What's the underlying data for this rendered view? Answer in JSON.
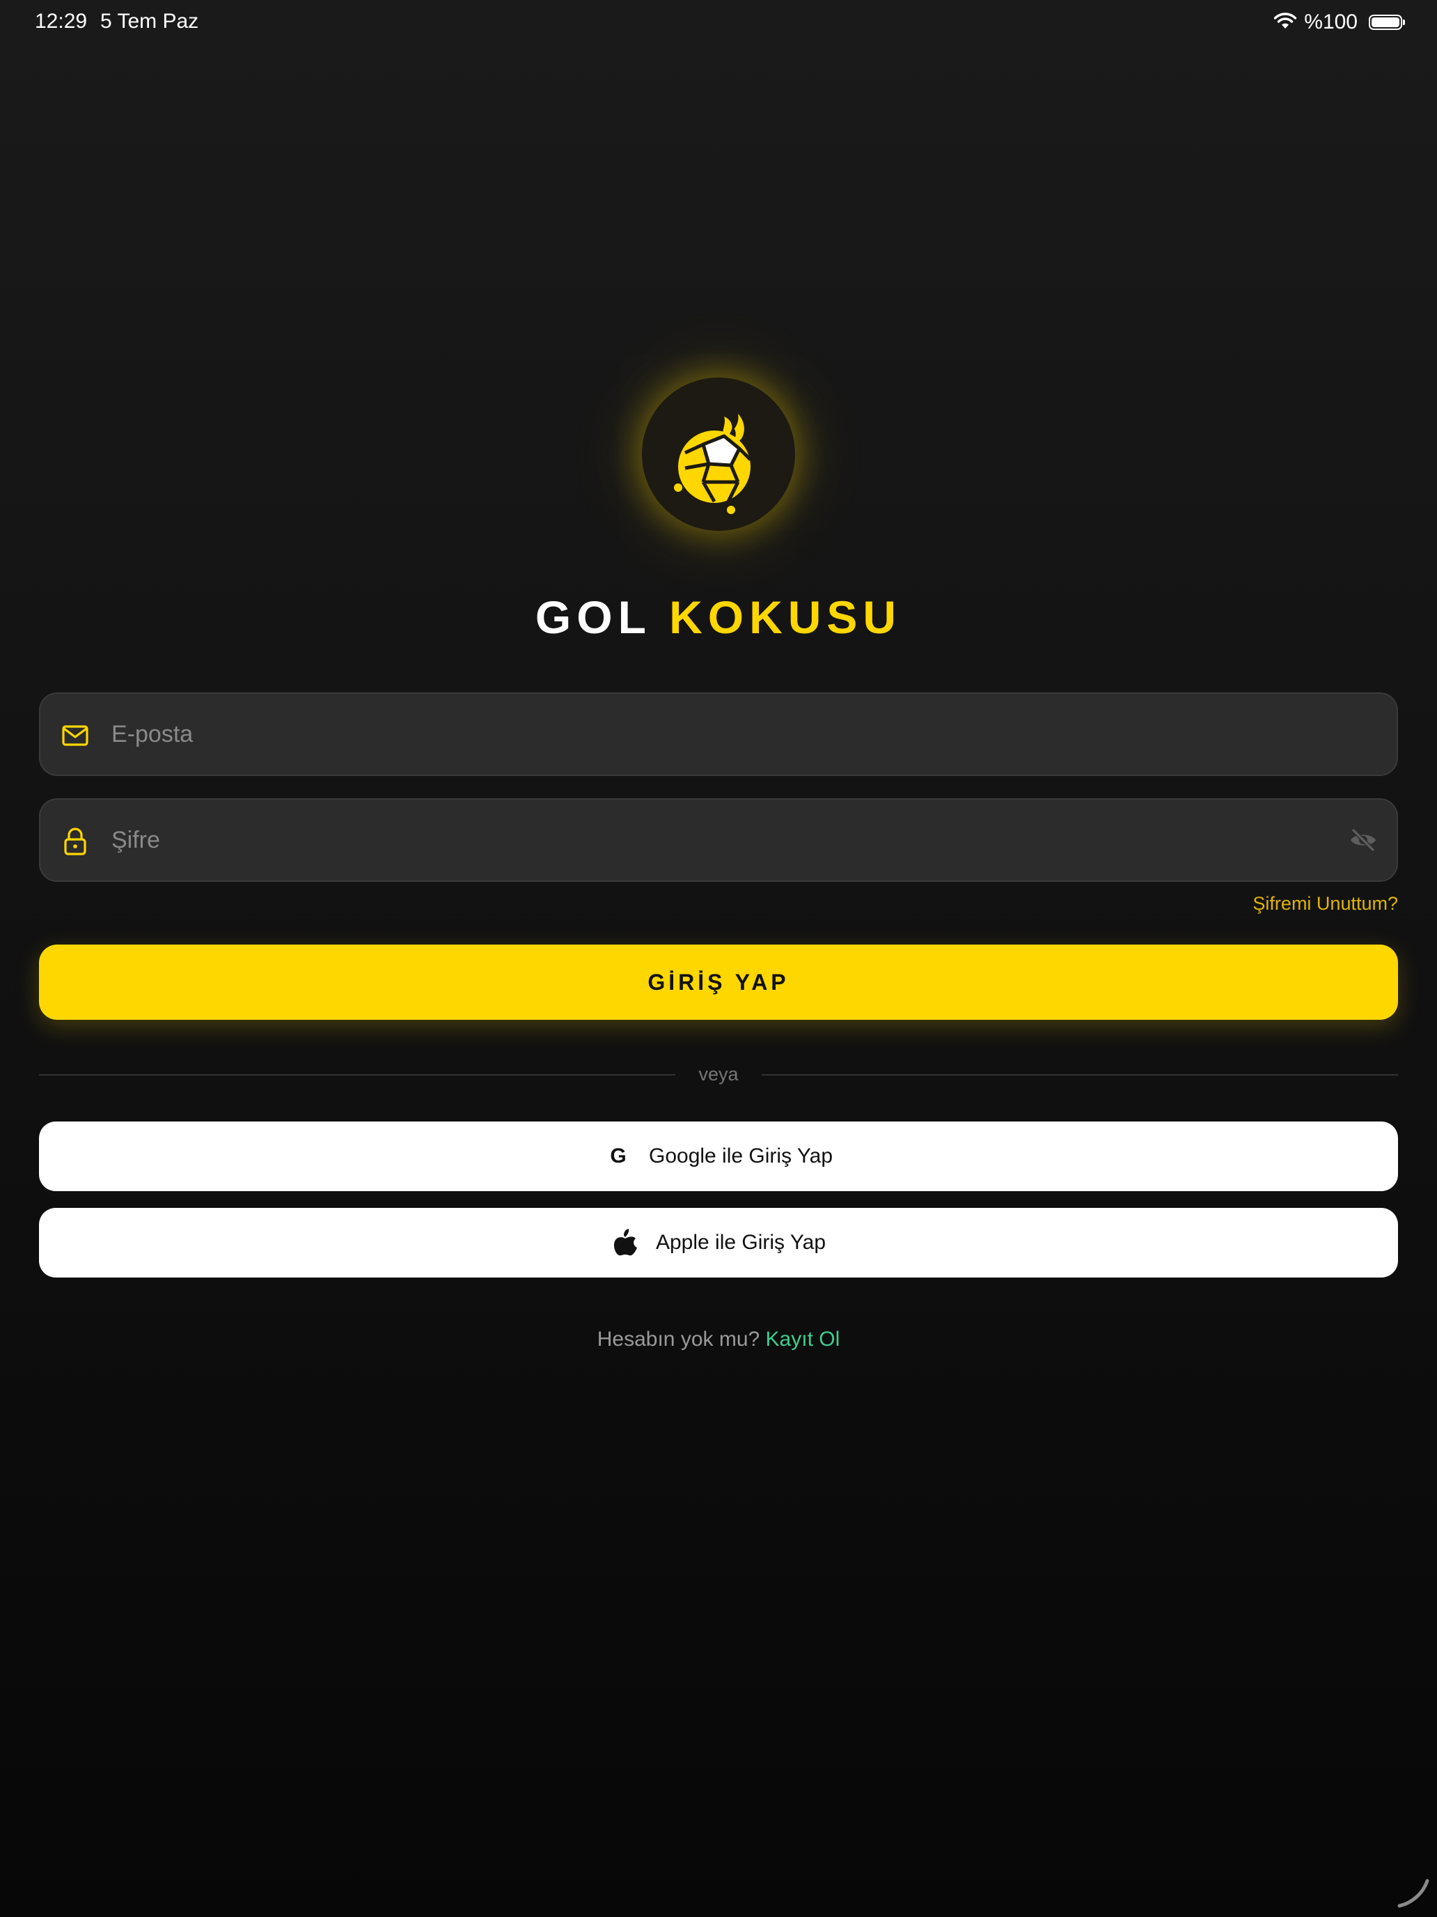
{
  "status_bar": {
    "time": "12:29",
    "date": "5 Tem Paz",
    "battery": "%100",
    "battery_level": 1.0
  },
  "brand": {
    "word1": "GOL",
    "word2": "KOKUSU",
    "accent_color": "#FFD700"
  },
  "form": {
    "email_placeholder": "E-posta",
    "email_value": "",
    "password_placeholder": "Şifre",
    "password_value": "",
    "forgot_password": "Şifremi Unuttum?",
    "login_button": "GİRİŞ YAP"
  },
  "divider": {
    "text": "veya"
  },
  "social": {
    "google_label": "Google ile Giriş Yap",
    "google_icon": "G",
    "apple_label": "Apple ile Giriş Yap"
  },
  "signup": {
    "prompt": "Hesabın yok mu?",
    "link": "Kayıt Ol",
    "link_color": "#3FCF8E"
  },
  "icons": {
    "email": "envelope-icon",
    "password": "lock-icon",
    "toggle": "eye-off-icon",
    "apple": "apple-icon",
    "google": "google-icon",
    "logo": "flaming-football-icon"
  }
}
